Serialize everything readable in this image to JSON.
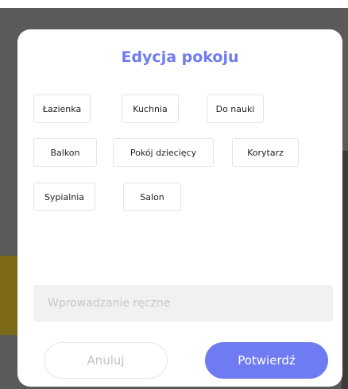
{
  "modal": {
    "title": "Edycja pokoju",
    "rooms": [
      "Łazienka",
      "Kuchnia",
      "Do nauki",
      "Balkon",
      "Pokój dziecięcy",
      "Korytarz",
      "Sypialnia",
      "Salon"
    ],
    "manual_input": {
      "placeholder": "Wprowadzanie ręczne",
      "value": ""
    },
    "cancel_label": "Anuluj",
    "confirm_label": "Potwierdź"
  },
  "colors": {
    "accent": "#6f7bf0",
    "overlay": "#5a5a5a"
  }
}
